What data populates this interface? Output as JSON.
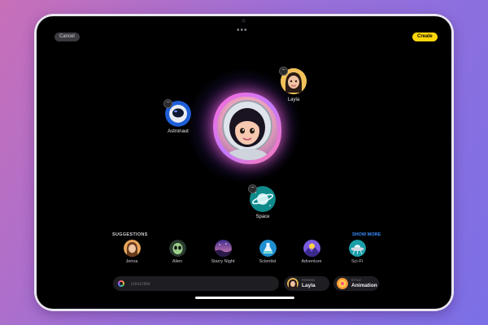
{
  "toolbar": {
    "cancel_label": "Cancel",
    "create_label": "Create",
    "more_label": "•••"
  },
  "canvas": {
    "bubbles": [
      {
        "label": "Layla",
        "icon": "person-icon"
      },
      {
        "label": "Astronaut",
        "icon": "astronaut-icon"
      },
      {
        "label": "Space",
        "icon": "planet-icon"
      }
    ],
    "remove_label": "−"
  },
  "suggestions": {
    "title": "SUGGESTIONS",
    "show_more": "SHOW MORE",
    "items": [
      {
        "label": "Jenna"
      },
      {
        "label": "Alien"
      },
      {
        "label": "Starry Night"
      },
      {
        "label": "Scientist"
      },
      {
        "label": "Adventure"
      },
      {
        "label": "Sci-Fi"
      }
    ]
  },
  "describe": {
    "placeholder": "Describe"
  },
  "person_chip": {
    "caption": "PERSON",
    "value": "Layla"
  },
  "style_chip": {
    "caption": "STYLE",
    "value": "Animation"
  },
  "colors": {
    "accent": "#3a8dff",
    "create": "#ffd60a",
    "glow": "#ff6ad5"
  }
}
